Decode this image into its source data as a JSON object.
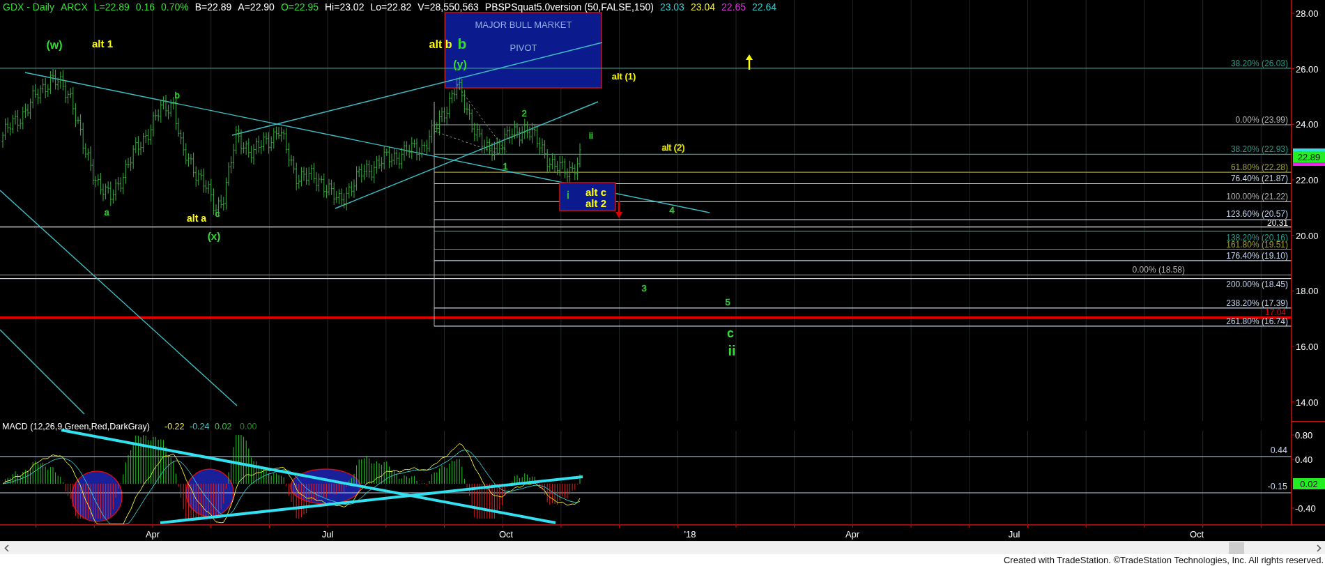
{
  "header": {
    "fields": [
      {
        "text": "GDX - Daily",
        "color": "#33dd33"
      },
      {
        "text": "ARCX",
        "color": "#33dd33"
      },
      {
        "text": "L=22.89",
        "color": "#33dd33"
      },
      {
        "text": "0.16",
        "color": "#33dd33"
      },
      {
        "text": "0.70%",
        "color": "#33dd33"
      },
      {
        "text": "B=22.89",
        "color": "#ffffff"
      },
      {
        "text": "A=22.90",
        "color": "#ffffff"
      },
      {
        "text": "O=22.95",
        "color": "#33dd33"
      },
      {
        "text": "Hi=23.02",
        "color": "#ffffff"
      },
      {
        "text": "Lo=22.82",
        "color": "#ffffff"
      },
      {
        "text": "V=28,550,563",
        "color": "#ffffff"
      },
      {
        "text": "PBSPSquat5.0version (50,FALSE,150)",
        "color": "#ffffff"
      },
      {
        "text": "23.03",
        "color": "#33cccc"
      },
      {
        "text": "23.04",
        "color": "#eeee33"
      },
      {
        "text": "22.65",
        "color": "#dd33dd"
      },
      {
        "text": "22.64",
        "color": "#33cccc"
      }
    ]
  },
  "chart": {
    "pivot_box": {
      "lines": [
        "MAJOR BULL MARKET",
        "PIVOT"
      ]
    },
    "annotations": [
      {
        "text": "(w)",
        "color": "#33dd33",
        "kind": "major"
      },
      {
        "text": "alt 1",
        "color": "#ffff00",
        "kind": "major"
      },
      {
        "text": "b",
        "color": "#33cc33",
        "kind": "minor"
      },
      {
        "text": "a",
        "color": "#33cc33",
        "kind": "minor"
      },
      {
        "text": "alt a",
        "color": "#ffff00",
        "kind": "major"
      },
      {
        "text": "c",
        "color": "#33cc33",
        "kind": "minor"
      },
      {
        "text": "(x)",
        "color": "#33dd33",
        "kind": "major"
      },
      {
        "text": "alt b",
        "color": "#ffff00",
        "kind": "major"
      },
      {
        "text": "b",
        "color": "#33dd33",
        "kind": "major"
      },
      {
        "text": "(y)",
        "color": "#33dd33",
        "kind": "major"
      },
      {
        "text": "alt (1)",
        "color": "#ffff00",
        "kind": "major"
      },
      {
        "text": "2",
        "color": "#33cc33",
        "kind": "minor"
      },
      {
        "text": "ii",
        "color": "#33cc33",
        "kind": "minor"
      },
      {
        "text": "1",
        "color": "#33cc33",
        "kind": "minor"
      },
      {
        "text": "alt (2)",
        "color": "#e6e600",
        "kind": "minor"
      },
      {
        "text": "i",
        "color": "#33cc33",
        "kind": "minor"
      },
      {
        "text": "alt c",
        "color": "#ffff00",
        "kind": "major"
      },
      {
        "text": "alt 2",
        "color": "#ffff00",
        "kind": "major"
      },
      {
        "text": "4",
        "color": "#33cc33",
        "kind": "minor"
      },
      {
        "text": "3",
        "color": "#33cc33",
        "kind": "minor"
      },
      {
        "text": "5",
        "color": "#33cc33",
        "kind": "minor"
      },
      {
        "text": "c",
        "color": "#33dd33",
        "kind": "major"
      },
      {
        "text": "ii",
        "color": "#33dd33",
        "kind": "major"
      }
    ],
    "levels": [
      {
        "label": "38.20% (26.03)",
        "color": "#2e9a88"
      },
      {
        "label": "0.00% (23.99)",
        "color": "#b4b4b4"
      },
      {
        "label": "38.20% (22.93)",
        "color": "#2e9a88"
      },
      {
        "label": "61.80% (22.28)",
        "color": "#a0a030"
      },
      {
        "label": "76.40% (21.87)",
        "color": "#c4d4ec"
      },
      {
        "label": "100.00% (21.22)",
        "color": "#b4b4b4"
      },
      {
        "label": "123.60% (20.57)",
        "color": "#c4d4ec"
      },
      {
        "label": "20.31",
        "color": "#e8e8e8"
      },
      {
        "label": "138.20% (20.16)",
        "color": "#2e9a88"
      },
      {
        "label": "161.80% (19.51)",
        "color": "#a0a030"
      },
      {
        "label": "176.40% (19.10)",
        "color": "#c4d4ec"
      },
      {
        "label": "0.00% (18.58)",
        "color": "#b4b4b4"
      },
      {
        "label": "200.00% (18.45)",
        "color": "#c4d4ec"
      },
      {
        "label": "238.20% (17.39)",
        "color": "#c4d4ec"
      },
      {
        "label": "17.04",
        "color": "#e00000"
      },
      {
        "label": "261.80% (16.74)",
        "color": "#c4d4ec"
      }
    ],
    "price_axis": {
      "ticks": [
        "28.00",
        "26.00",
        "24.00",
        "22.00",
        "20.00",
        "18.00",
        "16.00",
        "14.00"
      ],
      "last_price": "22.89"
    }
  },
  "macd": {
    "title": "MACD (12,26,9,Green,Red,DarkGray)",
    "values": [
      {
        "text": "-0.22",
        "color": "#eeee33"
      },
      {
        "text": "-0.24",
        "color": "#33cccc"
      },
      {
        "text": "0.02",
        "color": "#33cc33"
      },
      {
        "text": "0.00",
        "color": "#1f8f1f"
      }
    ],
    "levels": [
      "0.44",
      "-0.15"
    ],
    "ticks": [
      "0.80",
      "0.40",
      "-0.40"
    ],
    "last_value": "0.02"
  },
  "time_axis": {
    "labels": [
      "Apr",
      "Jul",
      "Oct",
      "'18",
      "Apr",
      "Jul",
      "Oct"
    ]
  },
  "footer": "Created with TradeStation. ©TradeStation Technologies, Inc. All rights reserved."
}
